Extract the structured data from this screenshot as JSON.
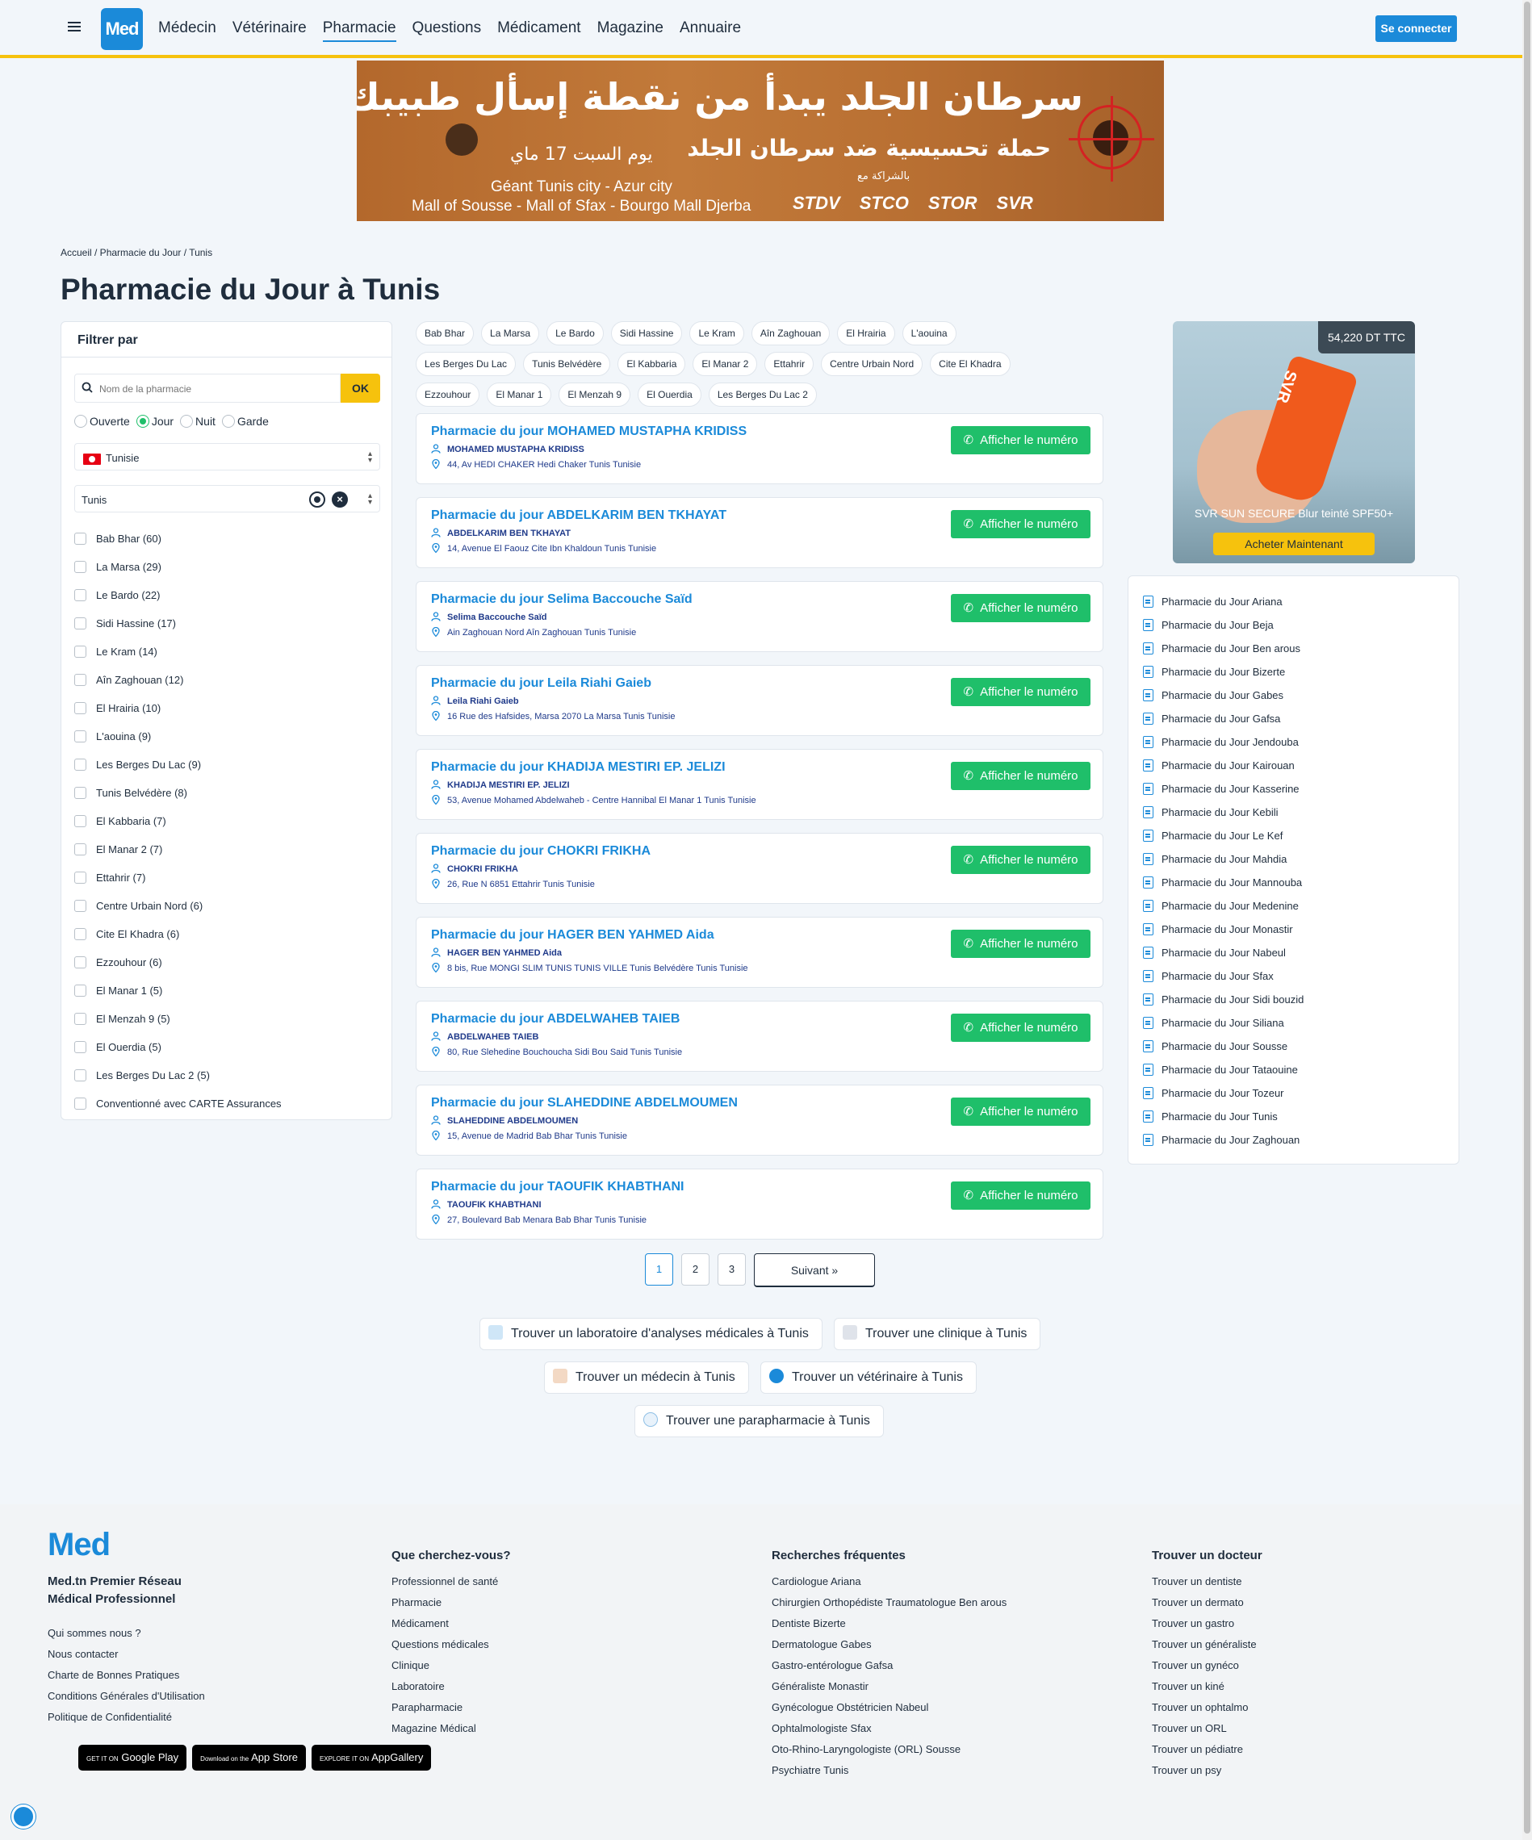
{
  "header": {
    "logo": "Med",
    "nav": [
      "Médecin",
      "Vétérinaire",
      "Pharmacie",
      "Questions",
      "Médicament",
      "Magazine",
      "Annuaire"
    ],
    "active_nav": "Pharmacie",
    "login": "Se connecter"
  },
  "banner": {
    "headline": "سرطان الجلد يبدأ من نقطة إسأل طبيبك؟",
    "campaign": "حملة تحسيسية ضد سرطان الجلد",
    "date": "يوم السبت 17 ماي",
    "partner_note": "بالشراكة مع",
    "locations_1": "Géant Tunis city - Azur city",
    "locations_2": "Mall of Sousse - Mall of Sfax - Bourgo Mall Djerba",
    "sponsors": [
      "STDV",
      "STCO",
      "STOR",
      "SVR"
    ]
  },
  "breadcrumb": "Accueil / Pharmacie du Jour / Tunis",
  "page_title": "Pharmacie du Jour à Tunis",
  "filter": {
    "heading": "Filtrer par",
    "search_placeholder": "Nom de la pharmacie",
    "ok": "OK",
    "radios": [
      "Ouverte",
      "Jour",
      "Nuit",
      "Garde"
    ],
    "selected_radio": "Jour",
    "country": "Tunisie",
    "city": "Tunis",
    "neighborhoods": [
      "Bab Bhar (60)",
      "La Marsa (29)",
      "Le Bardo (22)",
      "Sidi Hassine (17)",
      "Le Kram (14)",
      "Aîn Zaghouan (12)",
      "El Hrairia (10)",
      "L'aouina (9)",
      "Les Berges Du Lac (9)",
      "Tunis Belvédère (8)",
      "El Kabbaria (7)",
      "El Manar 2 (7)",
      "Ettahrir (7)",
      "Centre Urbain Nord (6)",
      "Cite El Khadra (6)",
      "Ezzouhour (6)",
      "El Manar 1 (5)",
      "El Menzah 9 (5)",
      "El Ouerdia (5)",
      "Les Berges Du Lac 2 (5)",
      "Conventionné avec CARTE Assurances"
    ]
  },
  "tags": [
    "Bab Bhar",
    "La Marsa",
    "Le Bardo",
    "Sidi Hassine",
    "Le Kram",
    "Aîn Zaghouan",
    "El Hrairia",
    "L'aouina",
    "Les Berges Du Lac",
    "Tunis Belvédère",
    "El Kabbaria",
    "El Manar 2",
    "Ettahrir",
    "Centre Urbain Nord",
    "Cite El Khadra",
    "Ezzouhour",
    "El Manar 1",
    "El Menzah 9",
    "El Ouerdia",
    "Les Berges Du Lac 2"
  ],
  "call_label": "Afficher le numéro",
  "pharmacies": [
    {
      "title": "Pharmacie du jour MOHAMED MUSTAPHA KRIDISS",
      "owner": "MOHAMED MUSTAPHA KRIDISS",
      "address": "44, Av HEDI CHAKER Hedi Chaker Tunis Tunisie"
    },
    {
      "title": "Pharmacie du jour ABDELKARIM BEN TKHAYAT",
      "owner": "ABDELKARIM BEN TKHAYAT",
      "address": "14, Avenue El Faouz Cite Ibn Khaldoun Tunis Tunisie"
    },
    {
      "title": "Pharmacie du jour Selima Baccouche Saïd",
      "owner": "Selima Baccouche Saïd",
      "address": "Ain Zaghouan Nord Aîn Zaghouan Tunis Tunisie"
    },
    {
      "title": "Pharmacie du jour Leila Riahi Gaieb",
      "owner": "Leila Riahi Gaieb",
      "address": "16 Rue des Hafsides, Marsa 2070 La Marsa Tunis Tunisie"
    },
    {
      "title": "Pharmacie du jour KHADIJA MESTIRI EP. JELIZI",
      "owner": "KHADIJA MESTIRI EP. JELIZI",
      "address": "53, Avenue Mohamed Abdelwaheb - Centre Hannibal El Manar 1 Tunis Tunisie"
    },
    {
      "title": "Pharmacie du jour CHOKRI FRIKHA",
      "owner": "CHOKRI FRIKHA",
      "address": "26, Rue N 6851 Ettahrir Tunis Tunisie"
    },
    {
      "title": "Pharmacie du jour HAGER BEN YAHMED Aida",
      "owner": "HAGER BEN YAHMED Aida",
      "address": "8 bis, Rue MONGI SLIM TUNIS TUNIS VILLE Tunis Belvédère Tunis Tunisie"
    },
    {
      "title": "Pharmacie du jour ABDELWAHEB TAIEB",
      "owner": "ABDELWAHEB TAIEB",
      "address": "80, Rue Slehedine Bouchoucha Sidi Bou Said Tunis Tunisie"
    },
    {
      "title": "Pharmacie du jour SLAHEDDINE ABDELMOUMEN",
      "owner": "SLAHEDDINE ABDELMOUMEN",
      "address": "15, Avenue de Madrid Bab Bhar Tunis Tunisie"
    },
    {
      "title": "Pharmacie du jour TAOUFIK KHABTHANI",
      "owner": "TAOUFIK KHABTHANI",
      "address": "27, Boulevard Bab Menara Bab Bhar Tunis Tunisie"
    }
  ],
  "pagination": {
    "pages": [
      "1",
      "2",
      "3"
    ],
    "current": "1",
    "next": "Suivant »"
  },
  "find_links": [
    "Trouver un laboratoire d'analyses médicales à Tunis",
    "Trouver une clinique à Tunis",
    "Trouver un médecin à Tunis",
    "Trouver un vétérinaire à Tunis",
    "Trouver une parapharmacie à Tunis"
  ],
  "ad": {
    "price": "54,220 DT TTC",
    "product": "SVR SUN SECURE Blur teinté SPF50+",
    "tube_label": "SVR",
    "cta": "Acheter Maintenant"
  },
  "regions": [
    "Pharmacie du Jour Ariana",
    "Pharmacie du Jour Beja",
    "Pharmacie du Jour Ben arous",
    "Pharmacie du Jour Bizerte",
    "Pharmacie du Jour Gabes",
    "Pharmacie du Jour Gafsa",
    "Pharmacie du Jour Jendouba",
    "Pharmacie du Jour Kairouan",
    "Pharmacie du Jour Kasserine",
    "Pharmacie du Jour Kebili",
    "Pharmacie du Jour Le Kef",
    "Pharmacie du Jour Mahdia",
    "Pharmacie du Jour Mannouba",
    "Pharmacie du Jour Medenine",
    "Pharmacie du Jour Monastir",
    "Pharmacie du Jour Nabeul",
    "Pharmacie du Jour Sfax",
    "Pharmacie du Jour Sidi bouzid",
    "Pharmacie du Jour Siliana",
    "Pharmacie du Jour Sousse",
    "Pharmacie du Jour Tataouine",
    "Pharmacie du Jour Tozeur",
    "Pharmacie du Jour Tunis",
    "Pharmacie du Jour Zaghouan"
  ],
  "footer": {
    "logo": "Med",
    "tagline_1": "Med.tn Premier Réseau",
    "tagline_2": "Médical Professionnel",
    "about_links": [
      "Qui sommes nous ?",
      "Nous contacter",
      "Charte de Bonnes Pratiques",
      "Conditions Générales d'Utilisation",
      "Politique de Confidentialité"
    ],
    "stores": [
      {
        "small": "GET IT ON",
        "big": "Google Play"
      },
      {
        "small": "Download on the",
        "big": "App Store"
      },
      {
        "small": "EXPLORE IT ON",
        "big": "AppGallery"
      }
    ],
    "col1": {
      "heading": "Que cherchez-vous?",
      "links": [
        "Professionnel de santé",
        "Pharmacie",
        "Médicament",
        "Questions médicales",
        "Clinique",
        "Laboratoire",
        "Parapharmacie",
        "Magazine Médical"
      ]
    },
    "col2": {
      "heading": "Recherches fréquentes",
      "links": [
        "Cardiologue Ariana",
        "Chirurgien Orthopédiste Traumatologue Ben arous",
        "Dentiste Bizerte",
        "Dermatologue Gabes",
        "Gastro-entérologue Gafsa",
        "Généraliste Monastir",
        "Gynécologue Obstétricien Nabeul",
        "Ophtalmologiste Sfax",
        "Oto-Rhino-Laryngologiste (ORL) Sousse",
        "Psychiatre Tunis"
      ]
    },
    "col3": {
      "heading": "Trouver un docteur",
      "links": [
        "Trouver un dentiste",
        "Trouver un dermato",
        "Trouver un gastro",
        "Trouver un généraliste",
        "Trouver un gynéco",
        "Trouver un kiné",
        "Trouver un ophtalmo",
        "Trouver un ORL",
        "Trouver un pédiatre",
        "Trouver un psy"
      ]
    }
  },
  "colors": {
    "brand": "#1b8ad9",
    "accent": "#f6c20d",
    "call": "#1fbf6a"
  }
}
